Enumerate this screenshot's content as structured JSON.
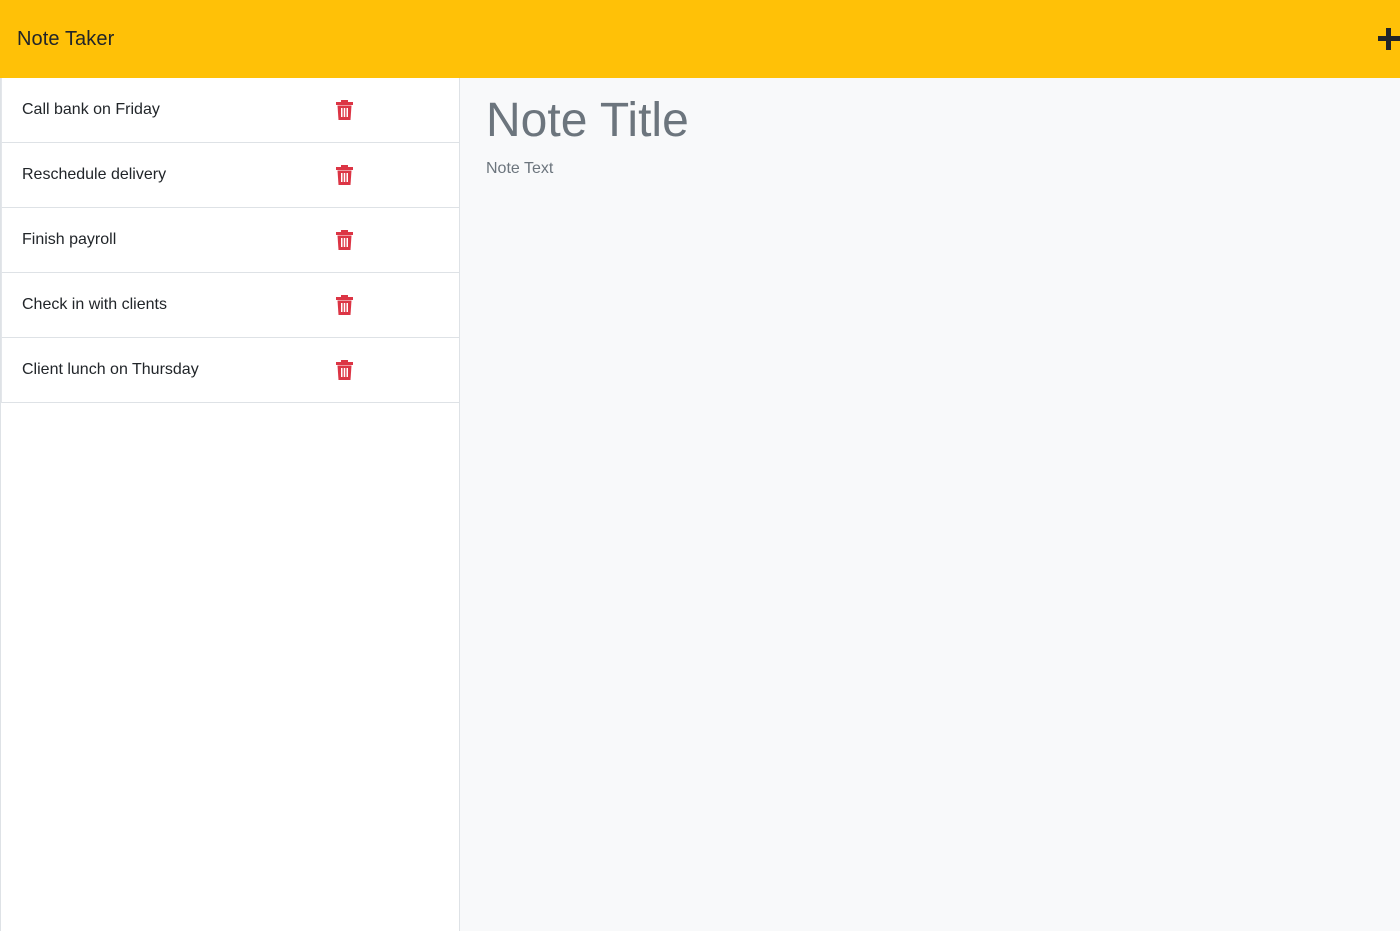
{
  "app": {
    "brand": "Note Taker",
    "new_note_icon": "plus-icon",
    "header_color": "#ffc107",
    "delete_color": "#dc3545"
  },
  "notes": [
    {
      "title": "Call bank on Friday",
      "delete_icon": "trash-icon"
    },
    {
      "title": "Reschedule delivery",
      "delete_icon": "trash-icon"
    },
    {
      "title": "Finish payroll",
      "delete_icon": "trash-icon"
    },
    {
      "title": "Check in with clients",
      "delete_icon": "trash-icon"
    },
    {
      "title": "Client lunch on Thursday",
      "delete_icon": "trash-icon"
    }
  ],
  "editor": {
    "title_placeholder": "Note Title",
    "title_value": "",
    "text_placeholder": "Note Text",
    "text_value": ""
  }
}
